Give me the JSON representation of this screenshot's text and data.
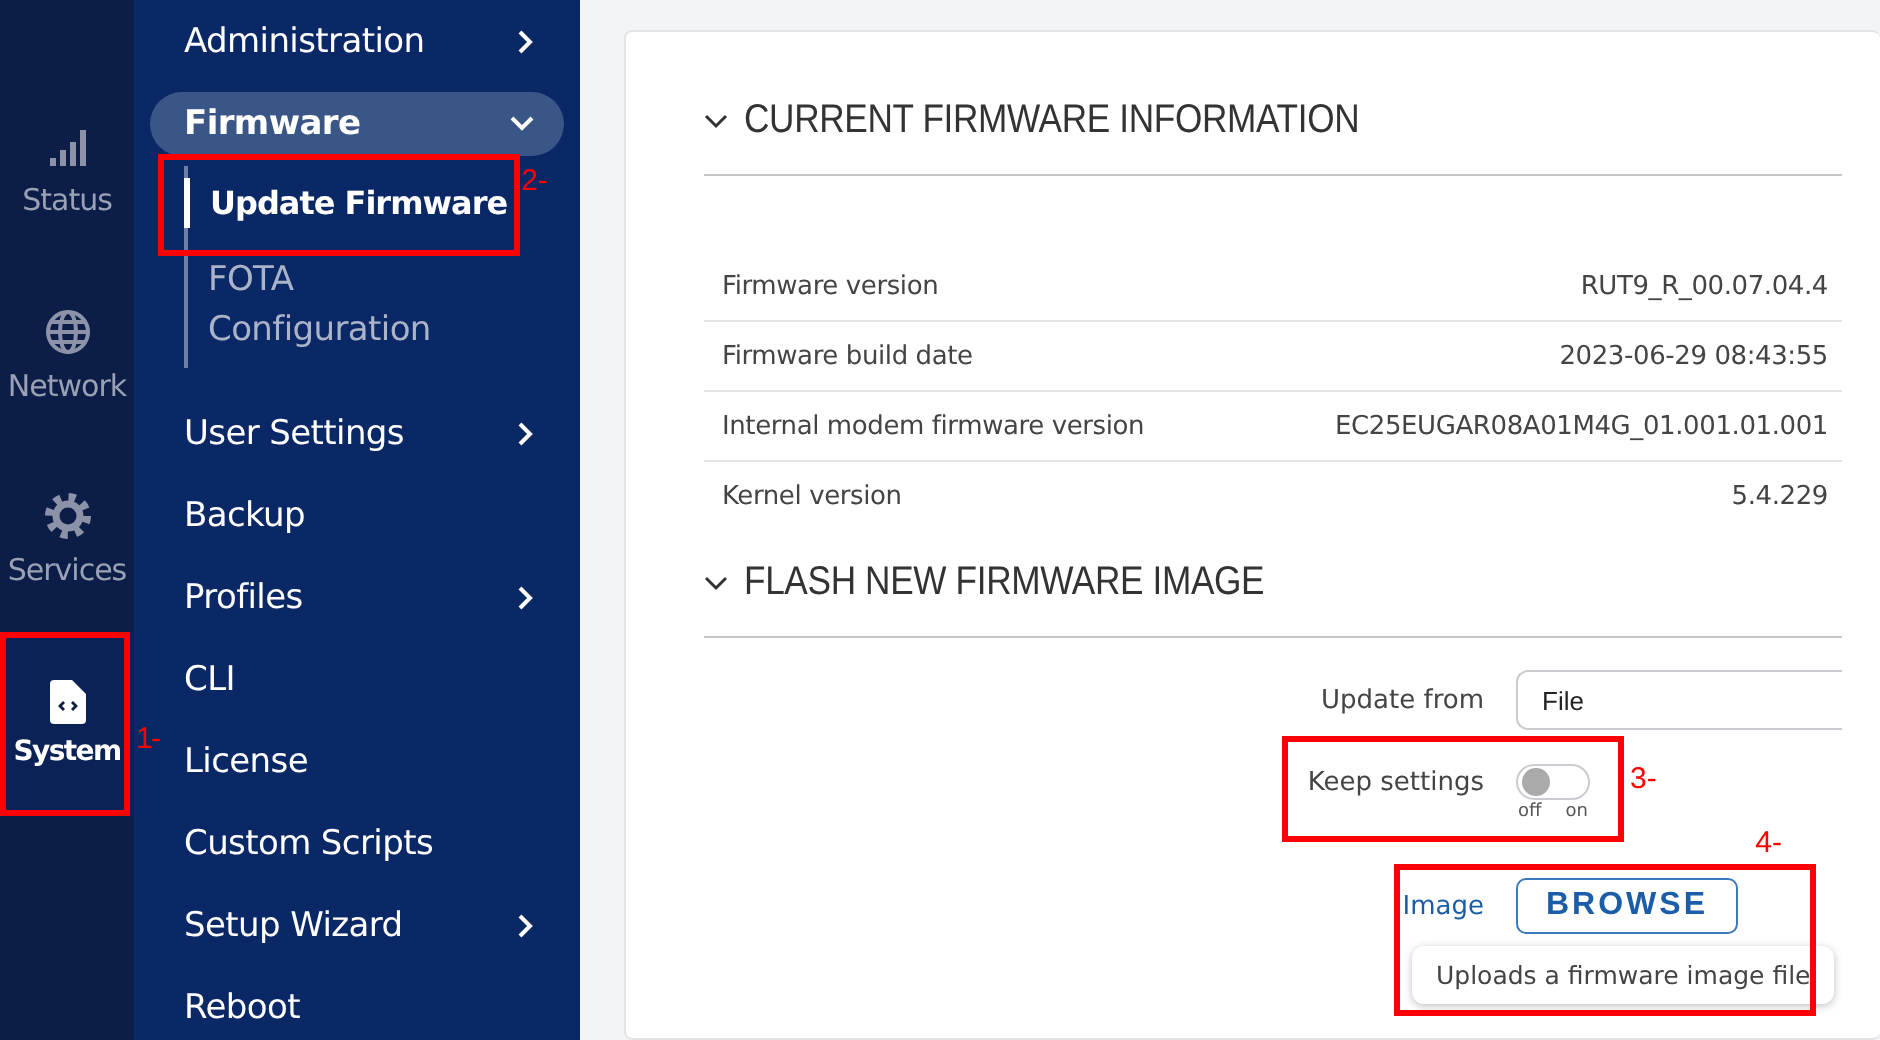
{
  "rail": [
    {
      "label": "Status",
      "selected": false
    },
    {
      "label": "Network",
      "selected": false
    },
    {
      "label": "Services",
      "selected": false
    },
    {
      "label": "System",
      "selected": true,
      "callout": "1-"
    }
  ],
  "submenu": [
    {
      "label": "Administration",
      "kind": "group",
      "expanded": false
    },
    {
      "label": "Firmware",
      "kind": "group",
      "expanded": true,
      "children": [
        {
          "label": "Update Firmware",
          "selected": true,
          "callout": "2-"
        },
        {
          "label": "FOTA Configuration",
          "selected": false
        }
      ]
    },
    {
      "label": "User Settings",
      "kind": "group",
      "expanded": false
    },
    {
      "label": "Backup",
      "kind": "link"
    },
    {
      "label": "Profiles",
      "kind": "group",
      "expanded": false
    },
    {
      "label": "CLI",
      "kind": "link"
    },
    {
      "label": "License",
      "kind": "link"
    },
    {
      "label": "Custom Scripts",
      "kind": "link"
    },
    {
      "label": "Setup Wizard",
      "kind": "group",
      "expanded": false
    },
    {
      "label": "Reboot",
      "kind": "link"
    }
  ],
  "sections": [
    {
      "title": "CURRENT FIRMWARE INFORMATION",
      "expanded": true,
      "rows": [
        {
          "label": "Firmware version",
          "value": "RUT9_R_00.07.04.4"
        },
        {
          "label": "Firmware build date",
          "value": "2023-06-29 08:43:55"
        },
        {
          "label": "Internal modem firmware version",
          "value": "EC25EUGAR08A01M4G_01.001.01.001"
        },
        {
          "label": "Kernel version",
          "value": "5.4.229"
        }
      ]
    },
    {
      "title": "FLASH NEW FIRMWARE IMAGE",
      "expanded": true,
      "fields": [
        {
          "kind": "select",
          "label": "Update from",
          "value": "File"
        },
        {
          "kind": "toggle",
          "label": "Keep settings",
          "on": false,
          "off_label": "off",
          "on_label": "on",
          "callout": "3-"
        },
        {
          "kind": "file",
          "label": "Image",
          "button": "BROWSE",
          "tooltip": "Uploads a firmware image file",
          "callout": "4-"
        }
      ]
    }
  ]
}
